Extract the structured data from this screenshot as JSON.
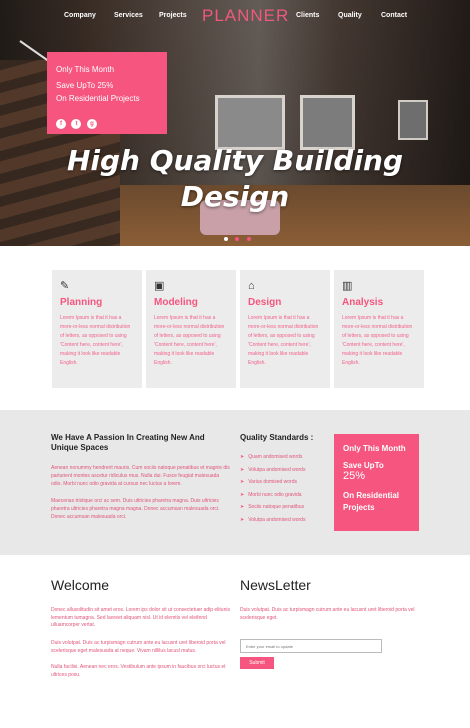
{
  "nav": {
    "logo": "PLANNER",
    "left": [
      "Company",
      "Services",
      "Projects"
    ],
    "right": [
      "Clients",
      "Quality",
      "Contact"
    ]
  },
  "promo": {
    "line1": "Only This Month",
    "line2": "Save UpTo 25%",
    "line3": "On Residential Projects",
    "social": [
      "f",
      "t",
      "g"
    ]
  },
  "hero": {
    "title_line1": "High Quality Building",
    "title_line2": "Design",
    "slides": 3,
    "active_slide": 1
  },
  "features": [
    {
      "icon": "edit-icon",
      "glyph": "✎",
      "title": "Planning",
      "text": "Lorem Ipsum is that it has a more-or-less normal distribution of letters, as opposed to using 'Content here, content here', making it look like readable English."
    },
    {
      "icon": "monitor-icon",
      "glyph": "▣",
      "title": "Modeling",
      "text": "Lorem Ipsum is that it has a more-or-less normal distribution of letters, as opposed to using 'Content here, content here', making it look like readable English."
    },
    {
      "icon": "home-icon",
      "glyph": "⌂",
      "title": "Design",
      "text": "Lorem Ipsum is that it has a more-or-less normal distribution of letters, as opposed to using 'Content here, content here', making it look like readable English."
    },
    {
      "icon": "chart-icon",
      "glyph": "▥",
      "title": "Analysis",
      "text": "Lorem Ipsum is that it has a more-or-less normal distribution of letters, as opposed to using 'Content here, content here', making it look like readable English."
    }
  ],
  "passion": {
    "heading": "We Have A Passion In Creating New And Unique Spaces",
    "para1": "Aenean nonummy hendrerit mauris. Cum sociis natoque penatibus et magnis dis parturient montes ascetur ridiculus mus. Nulla dui. Fusce feugiat malesuada odio. Morbi nunc odio gravida at cursus nec luctus a lorem.",
    "para2": "Maecenas tristique orci ac sem. Duis ultricies pharetra magna. Duis ultricies pharetra ultricies pharetra magna magna. Donec accumsan malesuada orci. Donec accumsan malesuada orci."
  },
  "quality": {
    "title": "Quality Standards :",
    "items": [
      "Quam andomised words",
      "Volutpa andomised words",
      "Varius domised words",
      "Morbi nunc odio gravida",
      "Sociis natoque penatibus",
      "Volutpa andomised words"
    ]
  },
  "promo2": {
    "line1": "Only This Month",
    "line2": "Save UpTo",
    "line3": "25%",
    "line4": "On Residential Projects"
  },
  "welcome": {
    "title": "Welcome",
    "para1": "Donec allusolitudin sit amet eros. Lorem ips dolor sit ut consectetuer adip elitunis lementum tumagna. Sed laoreet aliquam nisl. Ut id elemtis vel eleifend ulluamcorper vertat.",
    "para2": "Duis volutpat. Duis ac turpismagn cutrum ante eu lacusnt uret liberoid porta vel scelerisque eget malesuada at neque. Vivam nillilus lacusl matus.",
    "para3": "Nulla facilisi. Aenean nec eros. Vestibulum ante ipsum in faucibus orci luctus et ultrices posu."
  },
  "newsletter": {
    "title": "NewsLetter",
    "text": "Duis volutpat. Duis ac turpismagn cutrum ante eu lacusnt uret liberoid porta vel scelerisque eget.",
    "placeholder": "Enter your email to update",
    "button": "Submit"
  }
}
